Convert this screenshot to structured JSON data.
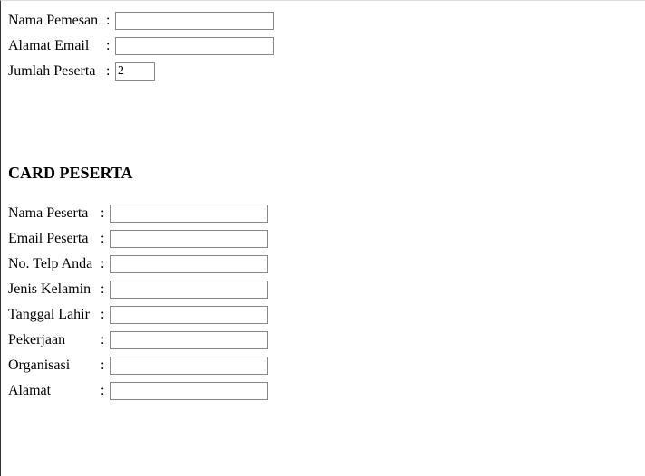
{
  "orderer": {
    "name_label": "Nama Pemesan",
    "email_label": "Alamat Email",
    "count_label": "Jumlah Peserta",
    "name_value": "",
    "email_value": "",
    "count_value": "2"
  },
  "section_heading": "CARD PESERTA",
  "participant": {
    "name_label": "Nama Peserta",
    "email_label": "Email Peserta",
    "phone_label": "No. Telp Anda",
    "gender_label": "Jenis Kelamin",
    "birthdate_label": "Tanggal Lahir",
    "occupation_label": "Pekerjaan",
    "organization_label": "Organisasi",
    "address_label": "Alamat",
    "name_value": "",
    "email_value": "",
    "phone_value": "",
    "gender_value": "",
    "birthdate_value": "",
    "occupation_value": "",
    "organization_value": "",
    "address_value": ""
  },
  "colon": ":"
}
